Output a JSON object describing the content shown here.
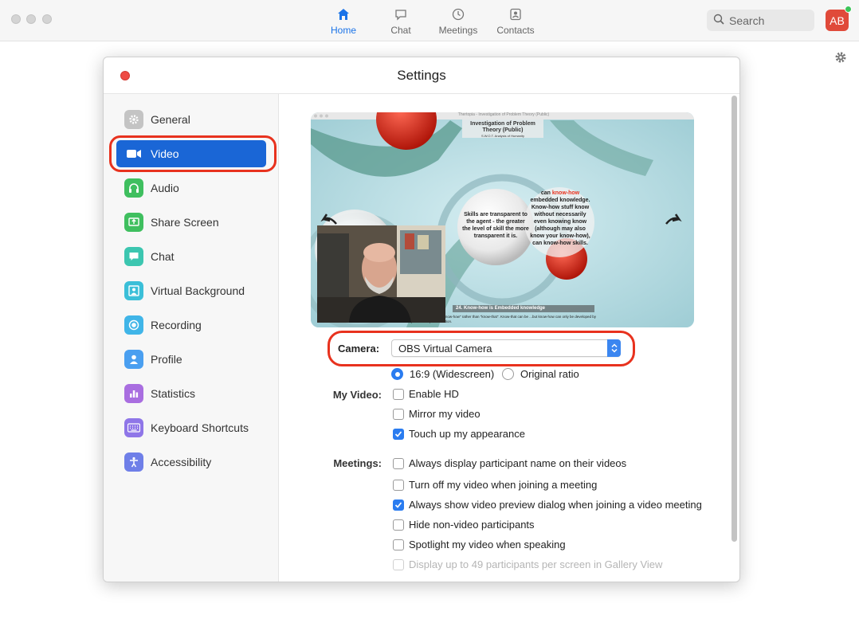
{
  "app": {
    "nav": [
      {
        "id": "home",
        "label": "Home",
        "icon": "home-icon",
        "active": true
      },
      {
        "id": "chat",
        "label": "Chat",
        "icon": "chat-icon",
        "active": false
      },
      {
        "id": "meetings",
        "label": "Meetings",
        "icon": "clock-icon",
        "active": false
      },
      {
        "id": "contacts",
        "label": "Contacts",
        "icon": "contact-card-icon",
        "active": false
      }
    ],
    "search_placeholder": "Search",
    "avatar_initials": "AB",
    "accent_color": "#1a66d6",
    "avatar_color": "#e04a3a"
  },
  "settings": {
    "title": "Settings",
    "sidebar": [
      {
        "label": "General",
        "icon": "gear-icon",
        "color": "#b8b8b8",
        "active": false
      },
      {
        "label": "Video",
        "icon": "video-camera-icon",
        "color": "#1a66d6",
        "active": true
      },
      {
        "label": "Audio",
        "icon": "headphones-icon",
        "color": "#3fbf5f",
        "active": false
      },
      {
        "label": "Share Screen",
        "icon": "share-screen-icon",
        "color": "#3fbf5f",
        "active": false
      },
      {
        "label": "Chat",
        "icon": "chat-bubble-icon",
        "color": "#3cc6b0",
        "active": false
      },
      {
        "label": "Virtual Background",
        "icon": "person-frame-icon",
        "color": "#3bbfd8",
        "active": false
      },
      {
        "label": "Recording",
        "icon": "record-icon",
        "color": "#40b5e8",
        "active": false
      },
      {
        "label": "Profile",
        "icon": "person-icon",
        "color": "#4a9ff0",
        "active": false
      },
      {
        "label": "Statistics",
        "icon": "bar-chart-icon",
        "color": "#a96ee0",
        "active": false
      },
      {
        "label": "Keyboard Shortcuts",
        "icon": "keyboard-icon",
        "color": "#8f76e8",
        "active": false
      },
      {
        "label": "Accessibility",
        "icon": "accessibility-icon",
        "color": "#6f7fe8",
        "active": false
      }
    ],
    "video": {
      "camera_label": "Camera:",
      "camera_value": "OBS Virtual Camera",
      "ratio_options": [
        {
          "label": "16:9 (Widescreen)",
          "selected": true
        },
        {
          "label": "Original ratio",
          "selected": false
        }
      ],
      "my_video_label": "My Video:",
      "my_video_options": [
        {
          "label": "Enable HD",
          "checked": false
        },
        {
          "label": "Mirror my video",
          "checked": false
        },
        {
          "label": "Touch up my appearance",
          "checked": true
        }
      ],
      "meetings_label": "Meetings:",
      "meetings_options": [
        {
          "label": "Always display participant name on their videos",
          "checked": false,
          "disabled": false
        },
        {
          "label": "Turn off my video when joining a meeting",
          "checked": false,
          "disabled": false
        },
        {
          "label": "Always show video preview dialog when joining a video meeting",
          "checked": true,
          "disabled": false
        },
        {
          "label": "Hide non-video participants",
          "checked": false,
          "disabled": false
        },
        {
          "label": "Spotlight my video when speaking",
          "checked": false,
          "disabled": false
        },
        {
          "label": "Display up to 49 participants per screen in Gallery View",
          "checked": false,
          "disabled": true
        }
      ]
    },
    "preview": {
      "window_title": "Thertopia - Investigation of Problem Theory (Public)",
      "slide_title": "Investigation of Problem Theory (Public)",
      "slide_subtitle": "S.W.O.T. Analysis of Humanity",
      "bubble_left": "Skills are transparent to the agent - the greater the level of skill the more transparent it is.",
      "bubble_right_highlight": "know-how",
      "bubble_right_before": "can ",
      "bubble_right_after": " embedded knowledge. Know-how stuff know without necessarily even knowing know (although may also know your know-how), can know-how skills.",
      "caption_title": "24. Know-how is Embedded knowledge",
      "caption_text": "...tant knowledge... \"know-how\" rather than \"know-that\". Know-that can be ...but know-how can only be developed by practical experimentation."
    }
  }
}
